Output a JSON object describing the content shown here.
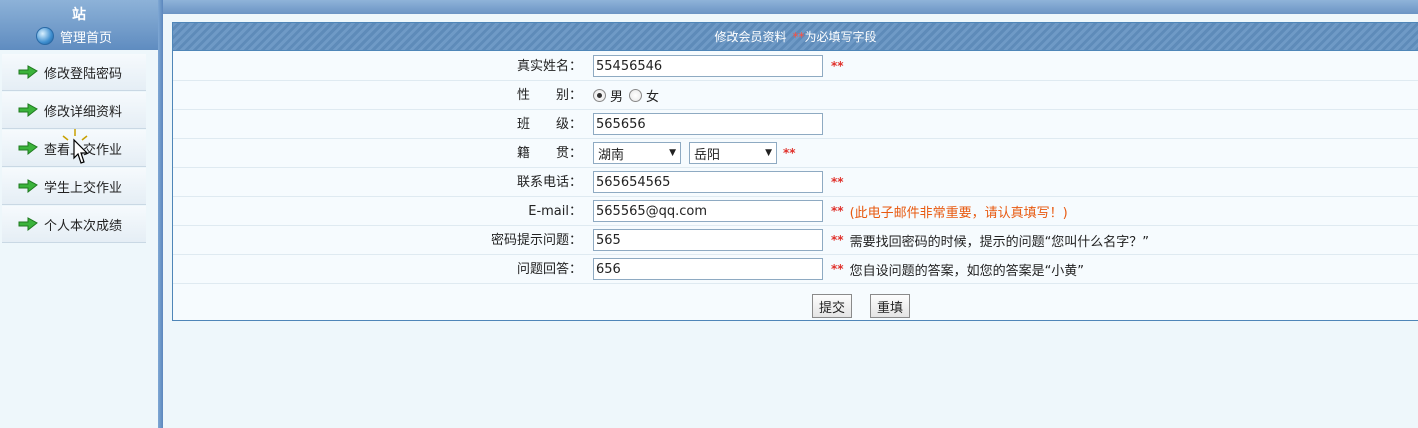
{
  "sidebar": {
    "site_label": "站",
    "home_label": "管理首页",
    "items": [
      {
        "label": "修改登陆密码"
      },
      {
        "label": "修改详细资料"
      },
      {
        "label": "查看上交作业"
      },
      {
        "label": "学生上交作业"
      },
      {
        "label": "个人本次成绩"
      }
    ]
  },
  "form": {
    "header_title": "修改会员资料",
    "header_req_mark": "**",
    "header_req_text": "为必填写字段",
    "required_mark": "**",
    "fields": {
      "real_name": {
        "label": "真实姓名：",
        "value": "55456546"
      },
      "gender": {
        "label": "性　　别：",
        "options": [
          "男",
          "女"
        ],
        "selected": "男"
      },
      "class": {
        "label": "班　　级：",
        "value": "565656"
      },
      "origin": {
        "label": "籍　　贯：",
        "province": "湖南",
        "city": "岳阳"
      },
      "phone": {
        "label": "联系电话：",
        "value": "565654565"
      },
      "email": {
        "label": "E-mail：",
        "value": "565565@qq.com",
        "hint": "(此电子邮件非常重要，请认真填写！)"
      },
      "question": {
        "label": "密码提示问题：",
        "value": "565",
        "hint": "需要找回密码的时候，提示的问题“您叫什么名字？”"
      },
      "answer": {
        "label": "问题回答：",
        "value": "656",
        "hint": "您自设问题的答案，如您的答案是“小黄”"
      }
    },
    "submit_label": "提交",
    "reset_label": "重填"
  },
  "colors": {
    "header_blue": "#6f9ac6",
    "required_red": "#e0302a",
    "hint_orange": "#e85a10"
  }
}
